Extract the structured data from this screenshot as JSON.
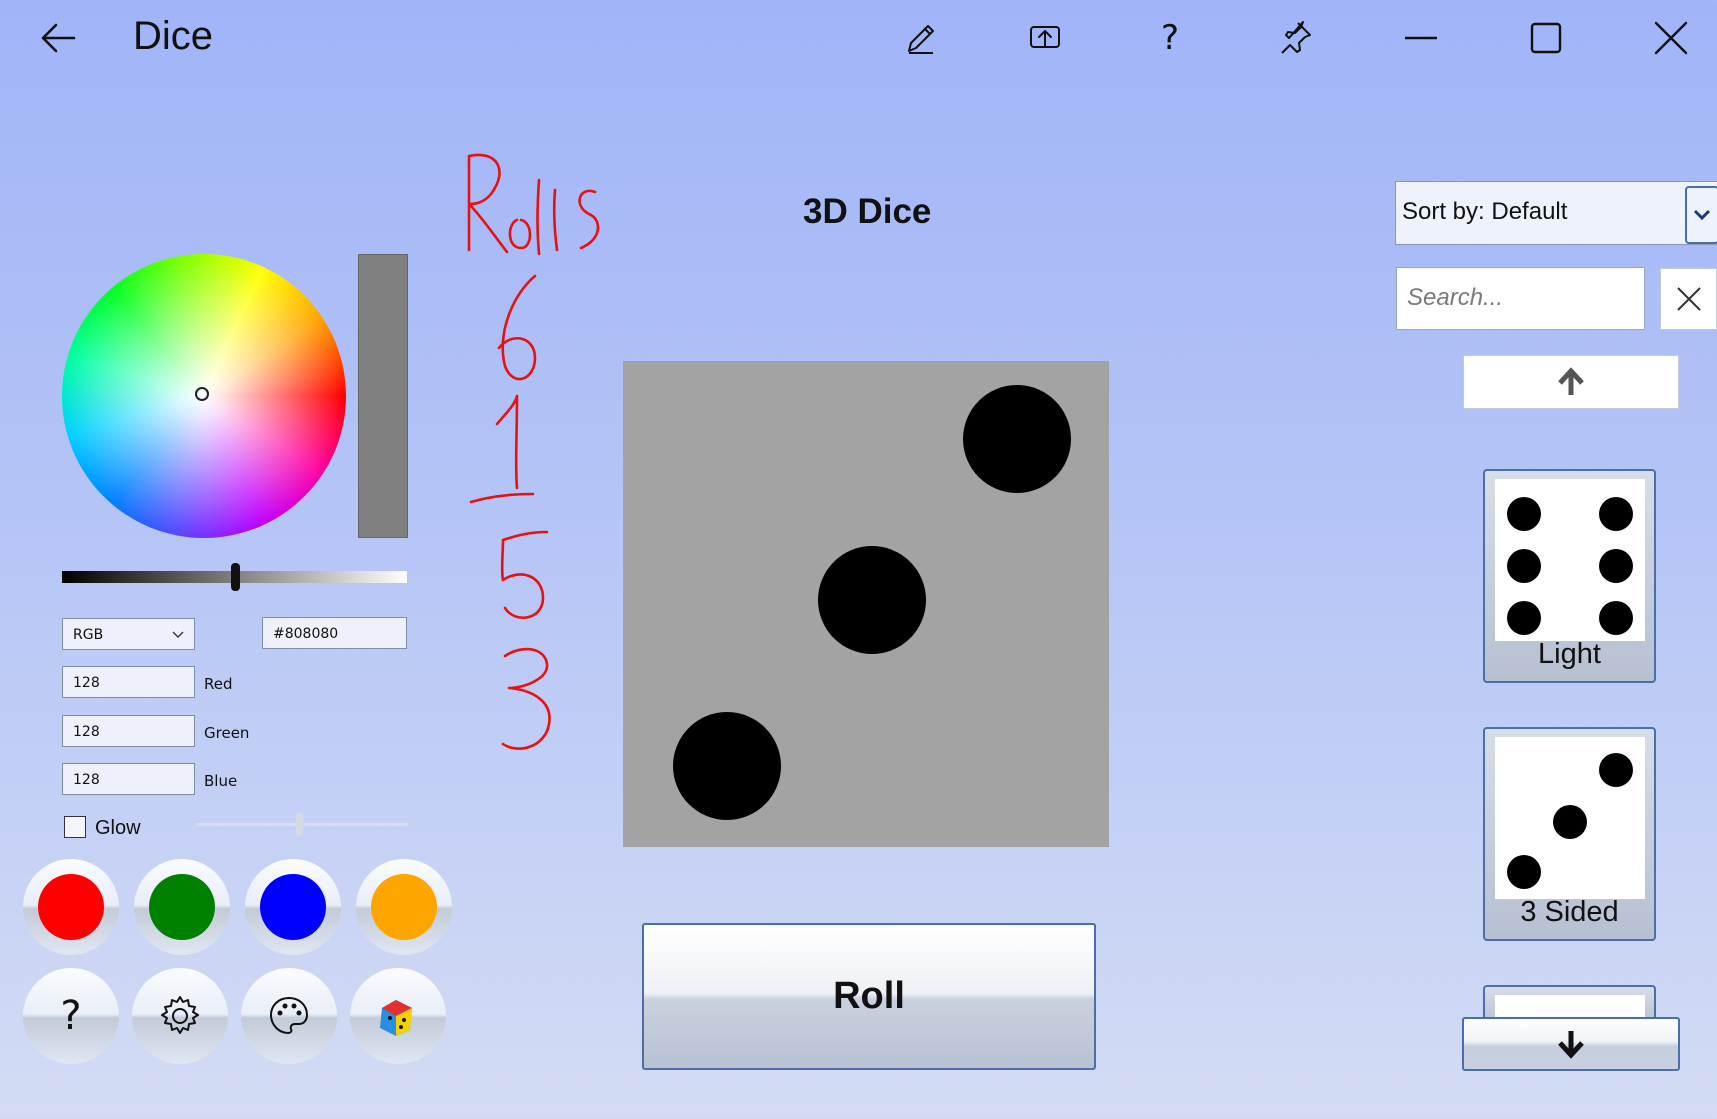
{
  "window": {
    "title": "Dice",
    "icons": [
      "back-arrow-icon",
      "pencil-icon",
      "share-icon",
      "help-icon",
      "pin-icon",
      "minimize-icon",
      "maximize-icon",
      "close-icon"
    ],
    "help_glyph": "?"
  },
  "color_picker": {
    "selected_color": "#808080",
    "mode": "RGB",
    "hex": "#808080",
    "channels": [
      {
        "value": "128",
        "label": "Red"
      },
      {
        "value": "128",
        "label": "Green"
      },
      {
        "value": "128",
        "label": "Blue"
      }
    ],
    "glow_label": "Glow",
    "glow_checked": false,
    "swatches": [
      "#ff0000",
      "#008000",
      "#0000ff",
      "#ffa500"
    ],
    "tool_buttons": [
      "help-icon",
      "gear-icon",
      "palette-icon",
      "dice-app-icon"
    ],
    "help_glyph": "?"
  },
  "main": {
    "heading": "3D Dice",
    "handwritten_title": "Rolls",
    "handwritten_rolls": [
      "6",
      "1",
      "5",
      "3"
    ],
    "die_value": 3,
    "die_color": "#a3a3a3",
    "roll_label": "Roll"
  },
  "sidebar": {
    "sort_label": "Sort by: Default",
    "search_placeholder": "Search...",
    "cards": [
      {
        "label": "Light",
        "pips": 6
      },
      {
        "label": "3 Sided",
        "pips": 3
      }
    ]
  }
}
